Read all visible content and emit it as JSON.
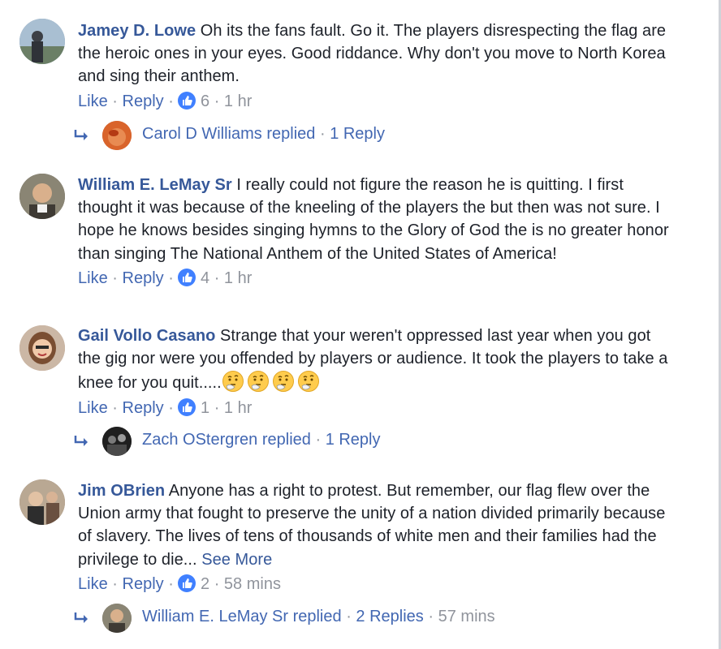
{
  "comments": [
    {
      "author": "Jamey D. Lowe",
      "text": "Oh its the fans fault. Go it. The players disrespecting the flag are the heroic ones in your eyes. Good riddance. Why don't you move to North Korea and sing their anthem.",
      "like": "Like",
      "reply": "Reply",
      "reactions": "6",
      "time": "1 hr",
      "replies_preview": {
        "name_text": "Carol D Williams replied",
        "count_text": "1 Reply"
      }
    },
    {
      "author": "William E. LeMay Sr",
      "text": "I really could not figure the reason he is quitting. I first thought it was because of the kneeling of the players the but then was not sure. I hope he knows besides singing hymns to the Glory of God the is no greater honor than singing The National Anthem of the United States of America!",
      "like": "Like",
      "reply": "Reply",
      "reactions": "4",
      "time": "1 hr"
    },
    {
      "author": "Gail Vollo Casano",
      "text": "Strange that your weren't oppressed last year when you got the gig nor were you offended by players or audience. It took the players to take a knee for you quit.....",
      "emoji_names": [
        "thinking-face-icon",
        "thinking-face-icon",
        "thinking-face-icon",
        "thinking-face-icon"
      ],
      "like": "Like",
      "reply": "Reply",
      "reactions": "1",
      "time": "1 hr",
      "replies_preview": {
        "name_text": "Zach OStergren replied",
        "count_text": "1 Reply"
      }
    },
    {
      "author": "Jim OBrien",
      "text": "Anyone has a right to protest. But remember, our flag flew over the Union army that fought to preserve the unity of a nation divided primarily because of slavery. The lives of tens of thousands of white men and their families had the privilege to die...",
      "see_more": "See More",
      "like": "Like",
      "reply": "Reply",
      "reactions": "2",
      "time": "58 mins",
      "replies_preview": {
        "name_text": "William E. LeMay Sr replied",
        "count_text": "2 Replies",
        "time": "57 mins"
      }
    }
  ],
  "separator": "·",
  "colors": {
    "link": "#4267b2",
    "author": "#365899",
    "muted": "#90949c",
    "like_badge": "#4080ff",
    "text": "#1d2129"
  }
}
